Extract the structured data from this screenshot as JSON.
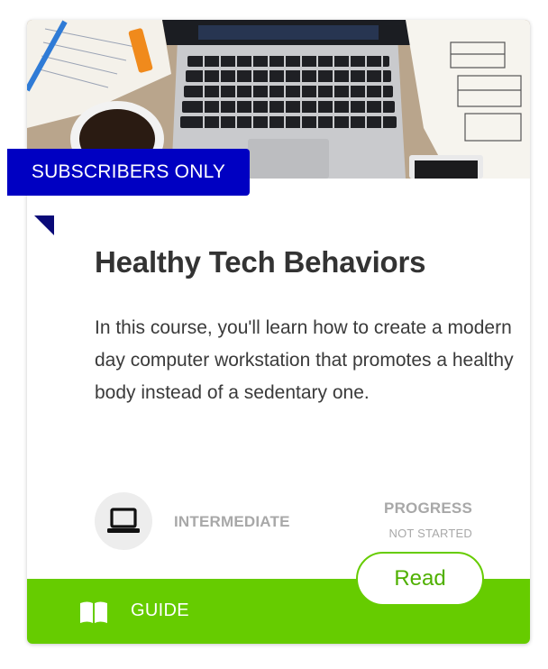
{
  "card": {
    "badge": "SUBSCRIBERS ONLY",
    "title": "Healthy Tech Behaviors",
    "description": "In this course, you'll learn how to create a modern day computer workstation that promotes a healthy body instead of a sedentary one.",
    "level": "INTERMEDIATE",
    "level_icon": "laptop-icon",
    "progress": {
      "label": "PROGRESS",
      "status": "NOT STARTED"
    },
    "footer": {
      "type_icon": "book-icon",
      "type_label": "GUIDE",
      "action_label": "Read"
    },
    "hero_image": "photo of a laptop, notebooks, coffee cup and phone on a wooden desk"
  },
  "colors": {
    "badge": "#0000c2",
    "footer": "#66cc00",
    "action_text": "#4fb000",
    "title": "#333333",
    "muted": "#a8a8a8"
  }
}
